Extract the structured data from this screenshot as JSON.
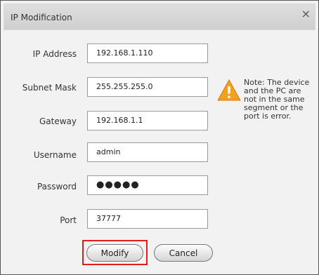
{
  "dialog": {
    "title": "IP Modification",
    "close_glyph": "×"
  },
  "form": {
    "ip_label": "IP Address",
    "ip_value": "192.168.1.110",
    "subnet_label": "Subnet Mask",
    "subnet_value": "255.255.255.0",
    "gateway_label": "Gateway",
    "gateway_value": "192.168.1.1",
    "username_label": "Username",
    "username_value": "admin",
    "password_label": "Password",
    "password_masked": "●●●●●",
    "port_label": "Port",
    "port_value": "37777"
  },
  "note": {
    "icon": "warning-icon",
    "text": "Note: The device and the PC are not in the same segment or the port is error."
  },
  "buttons": {
    "modify": "Modify",
    "cancel": "Cancel"
  },
  "colors": {
    "highlight": "#e01d1d",
    "warning": "#f0a21e"
  }
}
